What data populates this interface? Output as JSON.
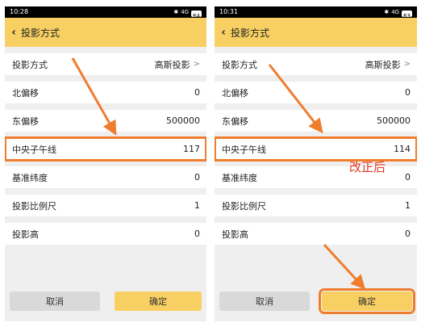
{
  "left": {
    "status_time": "10:28",
    "status_signal": "4G",
    "battery": "64",
    "title": "投影方式",
    "rows": [
      {
        "label": "投影方式",
        "value": "高斯投影",
        "chevron": ">"
      },
      {
        "label": "北偏移",
        "value": "0"
      },
      {
        "label": "东偏移",
        "value": "500000"
      },
      {
        "label": "中央子午线",
        "value": "117"
      },
      {
        "label": "基准纬度",
        "value": "0"
      },
      {
        "label": "投影比例尺",
        "value": "1"
      },
      {
        "label": "投影高",
        "value": "0"
      }
    ],
    "cancel_label": "取消",
    "confirm_label": "确定"
  },
  "right": {
    "status_time": "10:31",
    "status_signal": "4G",
    "battery": "63",
    "title": "投影方式",
    "rows": [
      {
        "label": "投影方式",
        "value": "高斯投影",
        "chevron": ">"
      },
      {
        "label": "北偏移",
        "value": "0"
      },
      {
        "label": "东偏移",
        "value": "500000"
      },
      {
        "label": "中央子午线",
        "value": "114"
      },
      {
        "label": "基准纬度",
        "value": "0"
      },
      {
        "label": "投影比例尺",
        "value": "1"
      },
      {
        "label": "投影高",
        "value": "0"
      }
    ],
    "cancel_label": "取消",
    "confirm_label": "确定"
  },
  "annotation": "改正后",
  "colors": {
    "accent_yellow": "#f7cf62",
    "highlight_orange": "#ef7d2e",
    "annotation_red": "#e03a2a"
  },
  "icons": [
    "back-chevron-icon",
    "bluetooth-icon",
    "signal-icon",
    "battery-icon",
    "chevron-right-icon"
  ]
}
